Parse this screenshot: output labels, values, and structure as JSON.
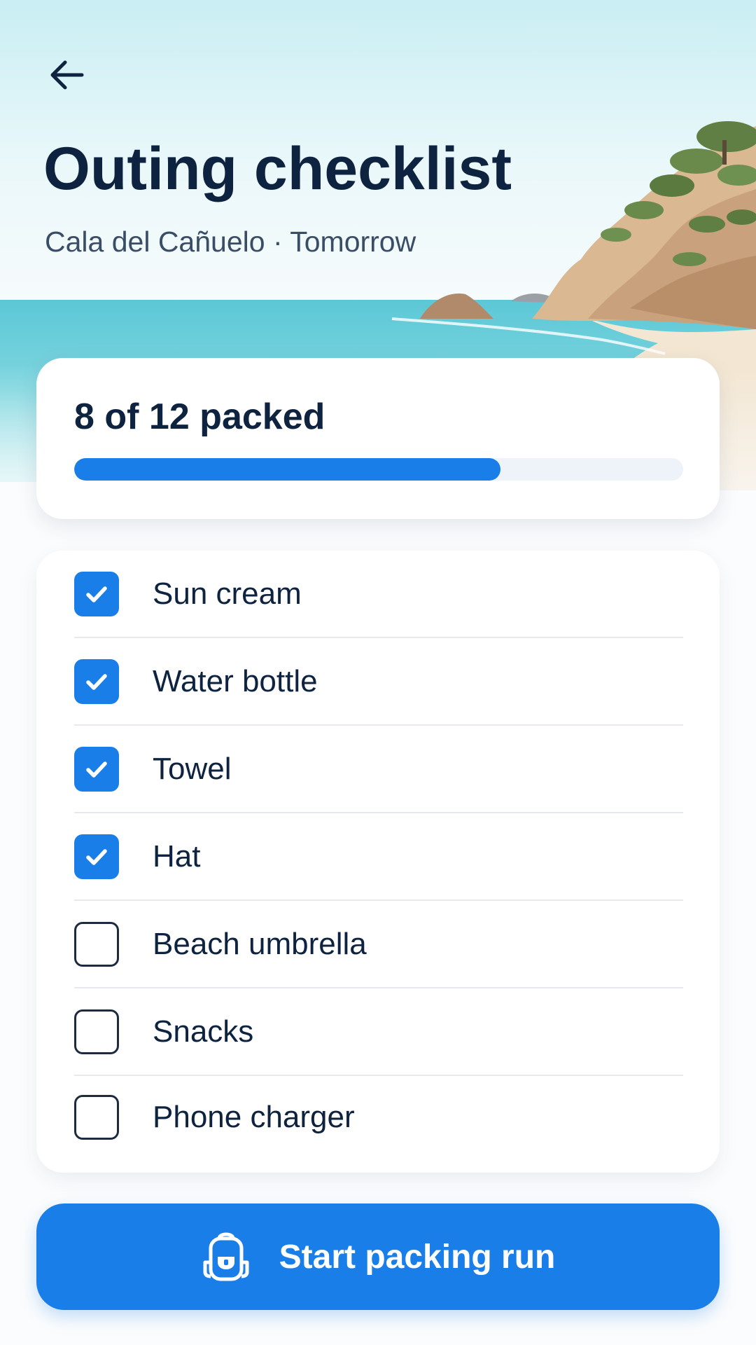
{
  "header": {
    "title": "Outing checklist",
    "subtitle": "Cala del Cañuelo · Tomorrow"
  },
  "progress": {
    "text": "8 of 12 packed",
    "packed": 8,
    "total": 12,
    "fraction": 0.7
  },
  "checklist": {
    "items": [
      {
        "label": "Sun cream",
        "checked": true
      },
      {
        "label": "Water bottle",
        "checked": true
      },
      {
        "label": "Towel",
        "checked": true
      },
      {
        "label": "Hat",
        "checked": true
      },
      {
        "label": "Beach umbrella",
        "checked": false
      },
      {
        "label": "Snacks",
        "checked": false
      },
      {
        "label": "Phone charger",
        "checked": false
      }
    ]
  },
  "action": {
    "label": "Start packing run",
    "icon": "backpack-icon"
  },
  "colors": {
    "accent": "#1a7ee8",
    "text_dark": "#0e2340",
    "text_muted": "#3a4d66"
  },
  "icons": {
    "back": "arrow-left-icon",
    "checked": "checkmark-icon"
  }
}
